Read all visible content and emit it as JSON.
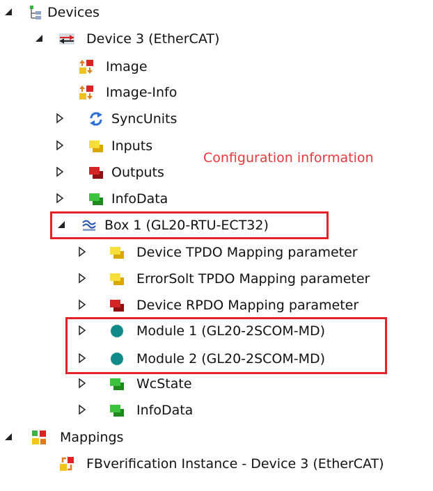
{
  "tree": {
    "devices": "Devices",
    "device3": "Device 3 (EtherCAT)",
    "image": "Image",
    "image_info": "Image-Info",
    "syncunits": "SyncUnits",
    "inputs": "Inputs",
    "outputs": "Outputs",
    "infodata": "InfoData",
    "box1": "Box 1 (GL20-RTU-ECT32)",
    "tpdo": "Device TPDO Mapping parameter",
    "errorsolt": "ErrorSolt TPDO Mapping parameter",
    "rpdo": "Device RPDO Mapping parameter",
    "module1": "Module 1 (GL20-2SCOM-MD)",
    "module2": "Module 2 (GL20-2SCOM-MD)",
    "wcstate": "WcState",
    "infodata2": "InfoData",
    "mappings": "Mappings",
    "fbverification": "FBverification Instance - Device 3 (EtherCAT)"
  },
  "annotation": "Configuration information",
  "colors": {
    "highlight": "#e8202a",
    "annotation": "#e8373a"
  }
}
